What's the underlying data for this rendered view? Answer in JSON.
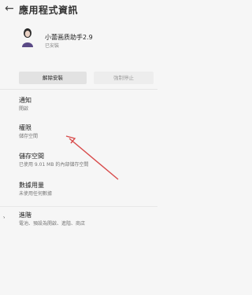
{
  "header": {
    "title": "應用程式資訊"
  },
  "app": {
    "name": "小蕾画质助手2.9",
    "status": "已安裝"
  },
  "buttons": {
    "uninstall": "解除安裝",
    "force_stop": "強制停止"
  },
  "settings": [
    {
      "title": "通知",
      "subtitle": "開啟"
    },
    {
      "title": "權限",
      "subtitle": "儲存空間"
    },
    {
      "title": "儲存空間",
      "subtitle": "已使用 9.01 MB 的內部儲存空間"
    },
    {
      "title": "數據用量",
      "subtitle": "未使用任何數據"
    },
    {
      "title": "進階",
      "subtitle": "電池、預設為開啟、進階、商店"
    }
  ],
  "colors": {
    "annotation_arrow": "#d84b4b"
  }
}
